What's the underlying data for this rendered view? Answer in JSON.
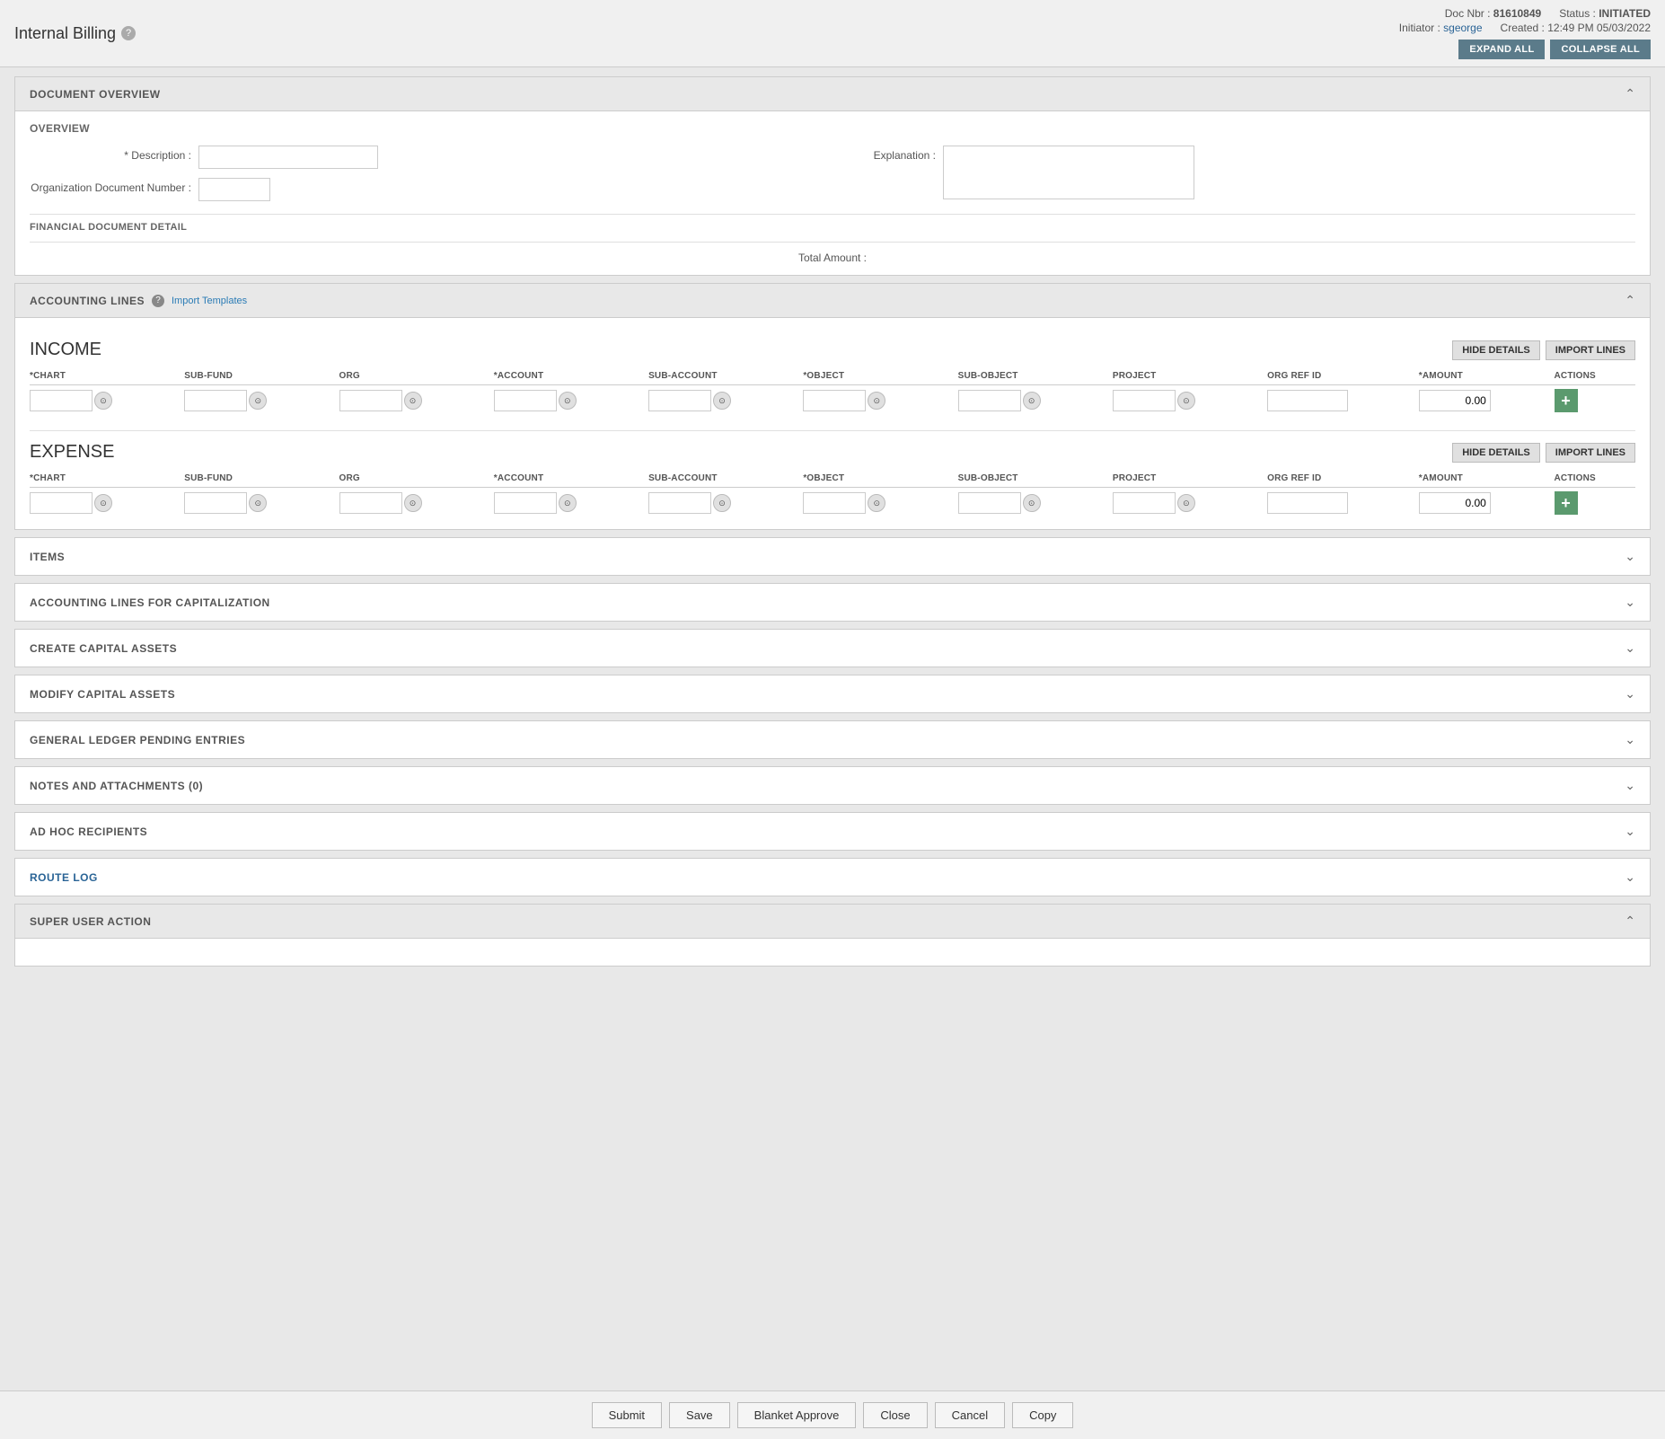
{
  "app": {
    "title": "Internal Billing",
    "help_label": "?"
  },
  "header": {
    "doc_nbr_label": "Doc Nbr :",
    "doc_nbr_value": "81610849",
    "status_label": "Status :",
    "status_value": "INITIATED",
    "initiator_label": "Initiator :",
    "initiator_value": "sgeorge",
    "created_label": "Created :",
    "created_value": "12:49 PM 05/03/2022",
    "expand_all": "EXPAND ALL",
    "collapse_all": "COLLAPSE ALL"
  },
  "document_overview": {
    "section_title": "DOCUMENT OVERVIEW",
    "subsection_title": "OVERVIEW",
    "description_label": "* Description :",
    "description_value": "",
    "explanation_label": "Explanation :",
    "explanation_value": "",
    "org_doc_number_label": "Organization Document Number :",
    "org_doc_number_value": "",
    "financial_detail_title": "FINANCIAL DOCUMENT DETAIL",
    "total_amount_label": "Total Amount :"
  },
  "accounting_lines": {
    "section_title": "ACCOUNTING LINES",
    "help_label": "?",
    "import_templates_label": "Import Templates",
    "income": {
      "title": "INCOME",
      "hide_details_label": "HIDE DETAILS",
      "import_lines_label": "IMPORT LINES",
      "columns": {
        "chart": "*CHART",
        "sub_fund": "SUB-FUND",
        "org": "ORG",
        "account": "*ACCOUNT",
        "sub_account": "SUB-ACCOUNT",
        "object": "*OBJECT",
        "sub_object": "SUB-OBJECT",
        "project": "PROJECT",
        "org_ref_id": "ORG REF ID",
        "amount": "*AMOUNT",
        "actions": "ACTIONS"
      },
      "amount_value": "0.00"
    },
    "expense": {
      "title": "EXPENSE",
      "hide_details_label": "HIDE DETAILS",
      "import_lines_label": "IMPORT LINES",
      "columns": {
        "chart": "*CHART",
        "sub_fund": "SUB-FUND",
        "org": "ORG",
        "account": "*ACCOUNT",
        "sub_account": "SUB-ACCOUNT",
        "object": "*OBJECT",
        "sub_object": "SUB-OBJECT",
        "project": "PROJECT",
        "org_ref_id": "ORG REF ID",
        "amount": "*AMOUNT",
        "actions": "ACTIONS"
      },
      "amount_value": "0.00"
    }
  },
  "collapsed_sections": [
    {
      "id": "items",
      "title": "ITEMS",
      "blue": false
    },
    {
      "id": "accounting-lines-cap",
      "title": "ACCOUNTING LINES FOR CAPITALIZATION",
      "blue": false
    },
    {
      "id": "create-capital",
      "title": "CREATE CAPITAL ASSETS",
      "blue": false
    },
    {
      "id": "modify-capital",
      "title": "MODIFY CAPITAL ASSETS",
      "blue": false
    },
    {
      "id": "gl-pending",
      "title": "GENERAL LEDGER PENDING ENTRIES",
      "blue": false
    },
    {
      "id": "notes-attachments",
      "title": "NOTES AND ATTACHMENTS (0)",
      "blue": false
    },
    {
      "id": "ad-hoc",
      "title": "AD HOC RECIPIENTS",
      "blue": false
    },
    {
      "id": "route-log",
      "title": "ROUTE LOG",
      "blue": true
    }
  ],
  "super_user": {
    "section_title": "SUPER USER ACTION",
    "is_open": true
  },
  "bottom_bar": {
    "submit": "Submit",
    "save": "Save",
    "blanket_approve": "Blanket Approve",
    "close": "Close",
    "cancel": "Cancel",
    "copy": "Copy"
  }
}
